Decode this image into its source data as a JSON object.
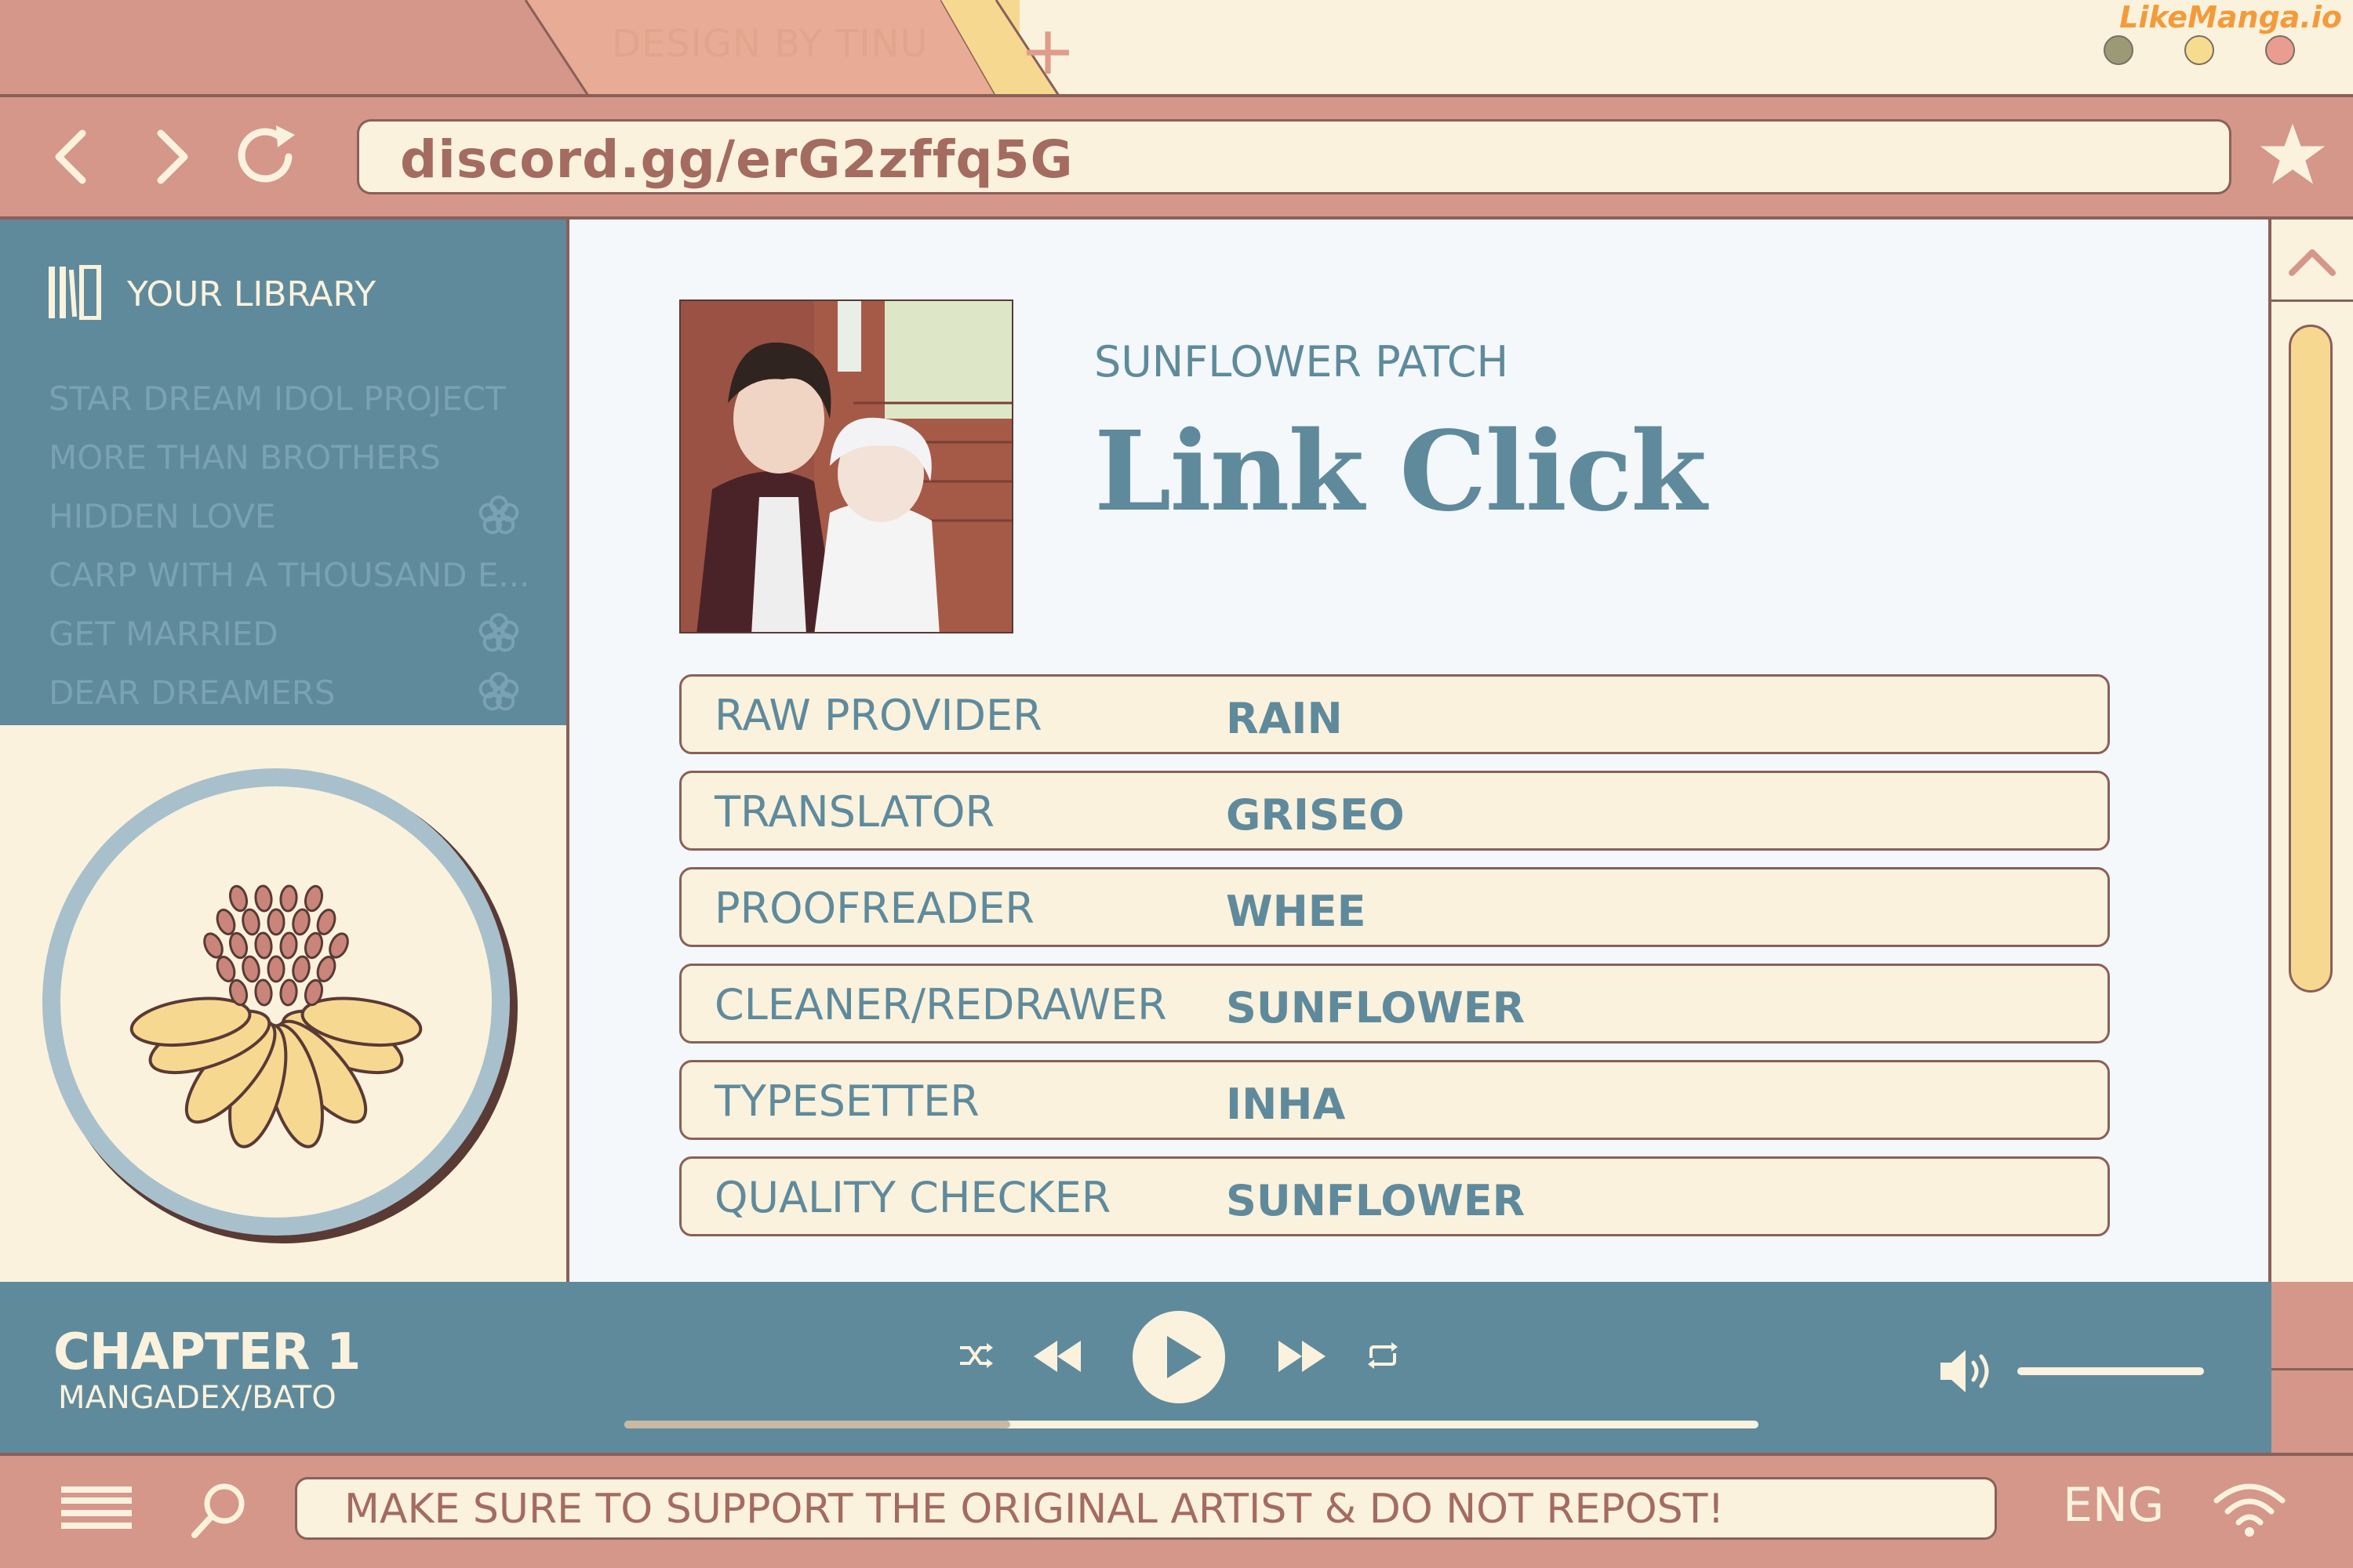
{
  "browser": {
    "tab_label": "DESIGN BY TINU",
    "new_tab_label": "+",
    "watermark": "LikeManga.io",
    "url": "discord.gg/erG2zffq5G",
    "icons": [
      "back-icon",
      "forward-icon",
      "reload-icon",
      "star-icon"
    ],
    "window_dot_colors": [
      "#9a9b76",
      "#f6dc8f",
      "#eb9c90"
    ]
  },
  "sidebar": {
    "header": "YOUR LIBRARY",
    "items": [
      {
        "label": "STAR DREAM IDOL PROJECT",
        "flower": false
      },
      {
        "label": "MORE THAN BROTHERS",
        "flower": false
      },
      {
        "label": "HIDDEN LOVE",
        "flower": true
      },
      {
        "label": "CARP WITH A THOUSAND E...",
        "flower": false
      },
      {
        "label": "GET MARRIED",
        "flower": true
      },
      {
        "label": "DEAR DREAMERS",
        "flower": true
      }
    ]
  },
  "main": {
    "group": "SUNFLOWER PATCH",
    "title": "Link Click",
    "credits": [
      {
        "role": "RAW PROVIDER",
        "name": "RAIN"
      },
      {
        "role": "TRANSLATOR",
        "name": "GRISEO"
      },
      {
        "role": "PROOFREADER",
        "name": "WHEE"
      },
      {
        "role": "CLEANER/REDRAWER",
        "name": "SUNFLOWER"
      },
      {
        "role": "TYPESETTER",
        "name": "INHA"
      },
      {
        "role": "QUALITY CHECKER",
        "name": "SUNFLOWER"
      }
    ]
  },
  "player": {
    "chapter": "CHAPTER 1",
    "source": "MANGADEX/BATO",
    "progress": 0.34,
    "volume": 1.0
  },
  "bottom": {
    "notice": "MAKE SURE TO SUPPORT THE ORIGINAL ARTIST & DO NOT REPOST!",
    "language": "ENG"
  },
  "colors": {
    "pink": "#d4978a",
    "cream": "#faf2dd",
    "teal": "#5f8a9c",
    "yellow": "#f7d891",
    "brown": "#8a6058"
  }
}
